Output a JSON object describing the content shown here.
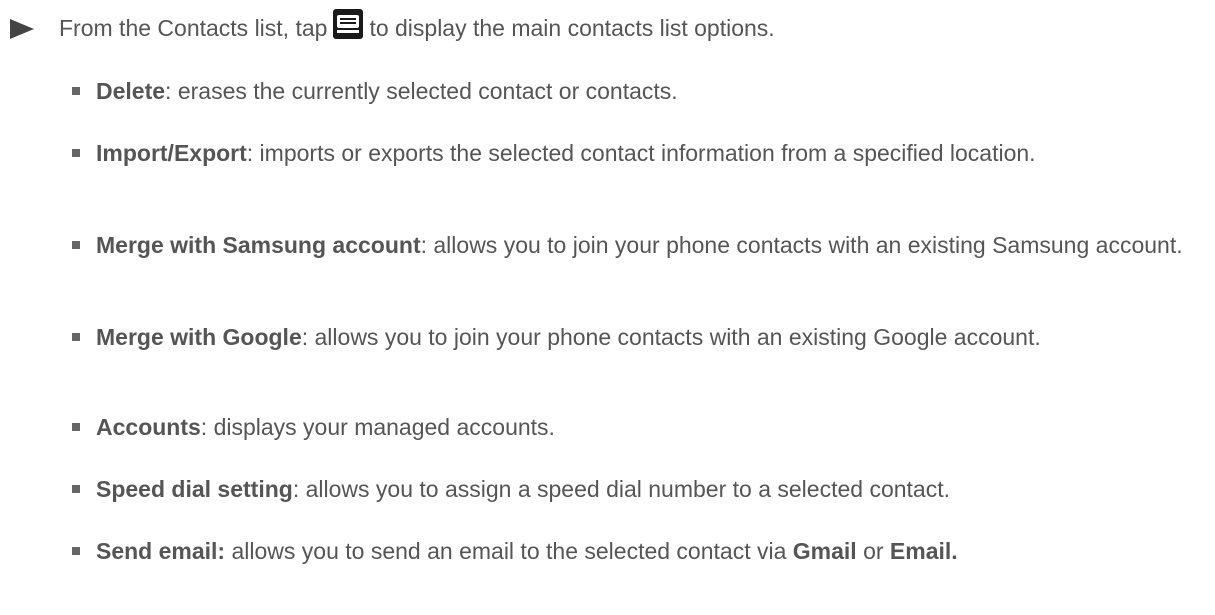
{
  "intro": {
    "before": "From the Contacts list, tap",
    "after": "to display the main contacts list options.",
    "icon": "menu-icon"
  },
  "options": [
    {
      "term": "Delete",
      "desc": ": erases the currently selected contact or contacts."
    },
    {
      "term": "Import/Export",
      "desc": ": imports or exports the selected contact information from a specified location."
    },
    {
      "term": "Merge with Samsung account",
      "desc": ": allows you to join your phone contacts with an existing Samsung account."
    },
    {
      "term": "Merge with Google",
      "desc": ": allows you to join your phone contacts with an existing Google account."
    },
    {
      "term": "Accounts",
      "desc": ": displays your managed accounts."
    },
    {
      "term": "Speed dial setting",
      "desc": ": allows you to assign a speed dial number to a selected contact."
    },
    {
      "term": "Send email:",
      "desc": " allows you to send an email to the selected contact via ",
      "bold1": "Gmail",
      "mid": " or ",
      "bold2": "Email."
    }
  ],
  "colors": {
    "text": "#555555",
    "arrow": "#444444",
    "bullet": "#666666",
    "icon_bg": "#1a1a1a"
  }
}
